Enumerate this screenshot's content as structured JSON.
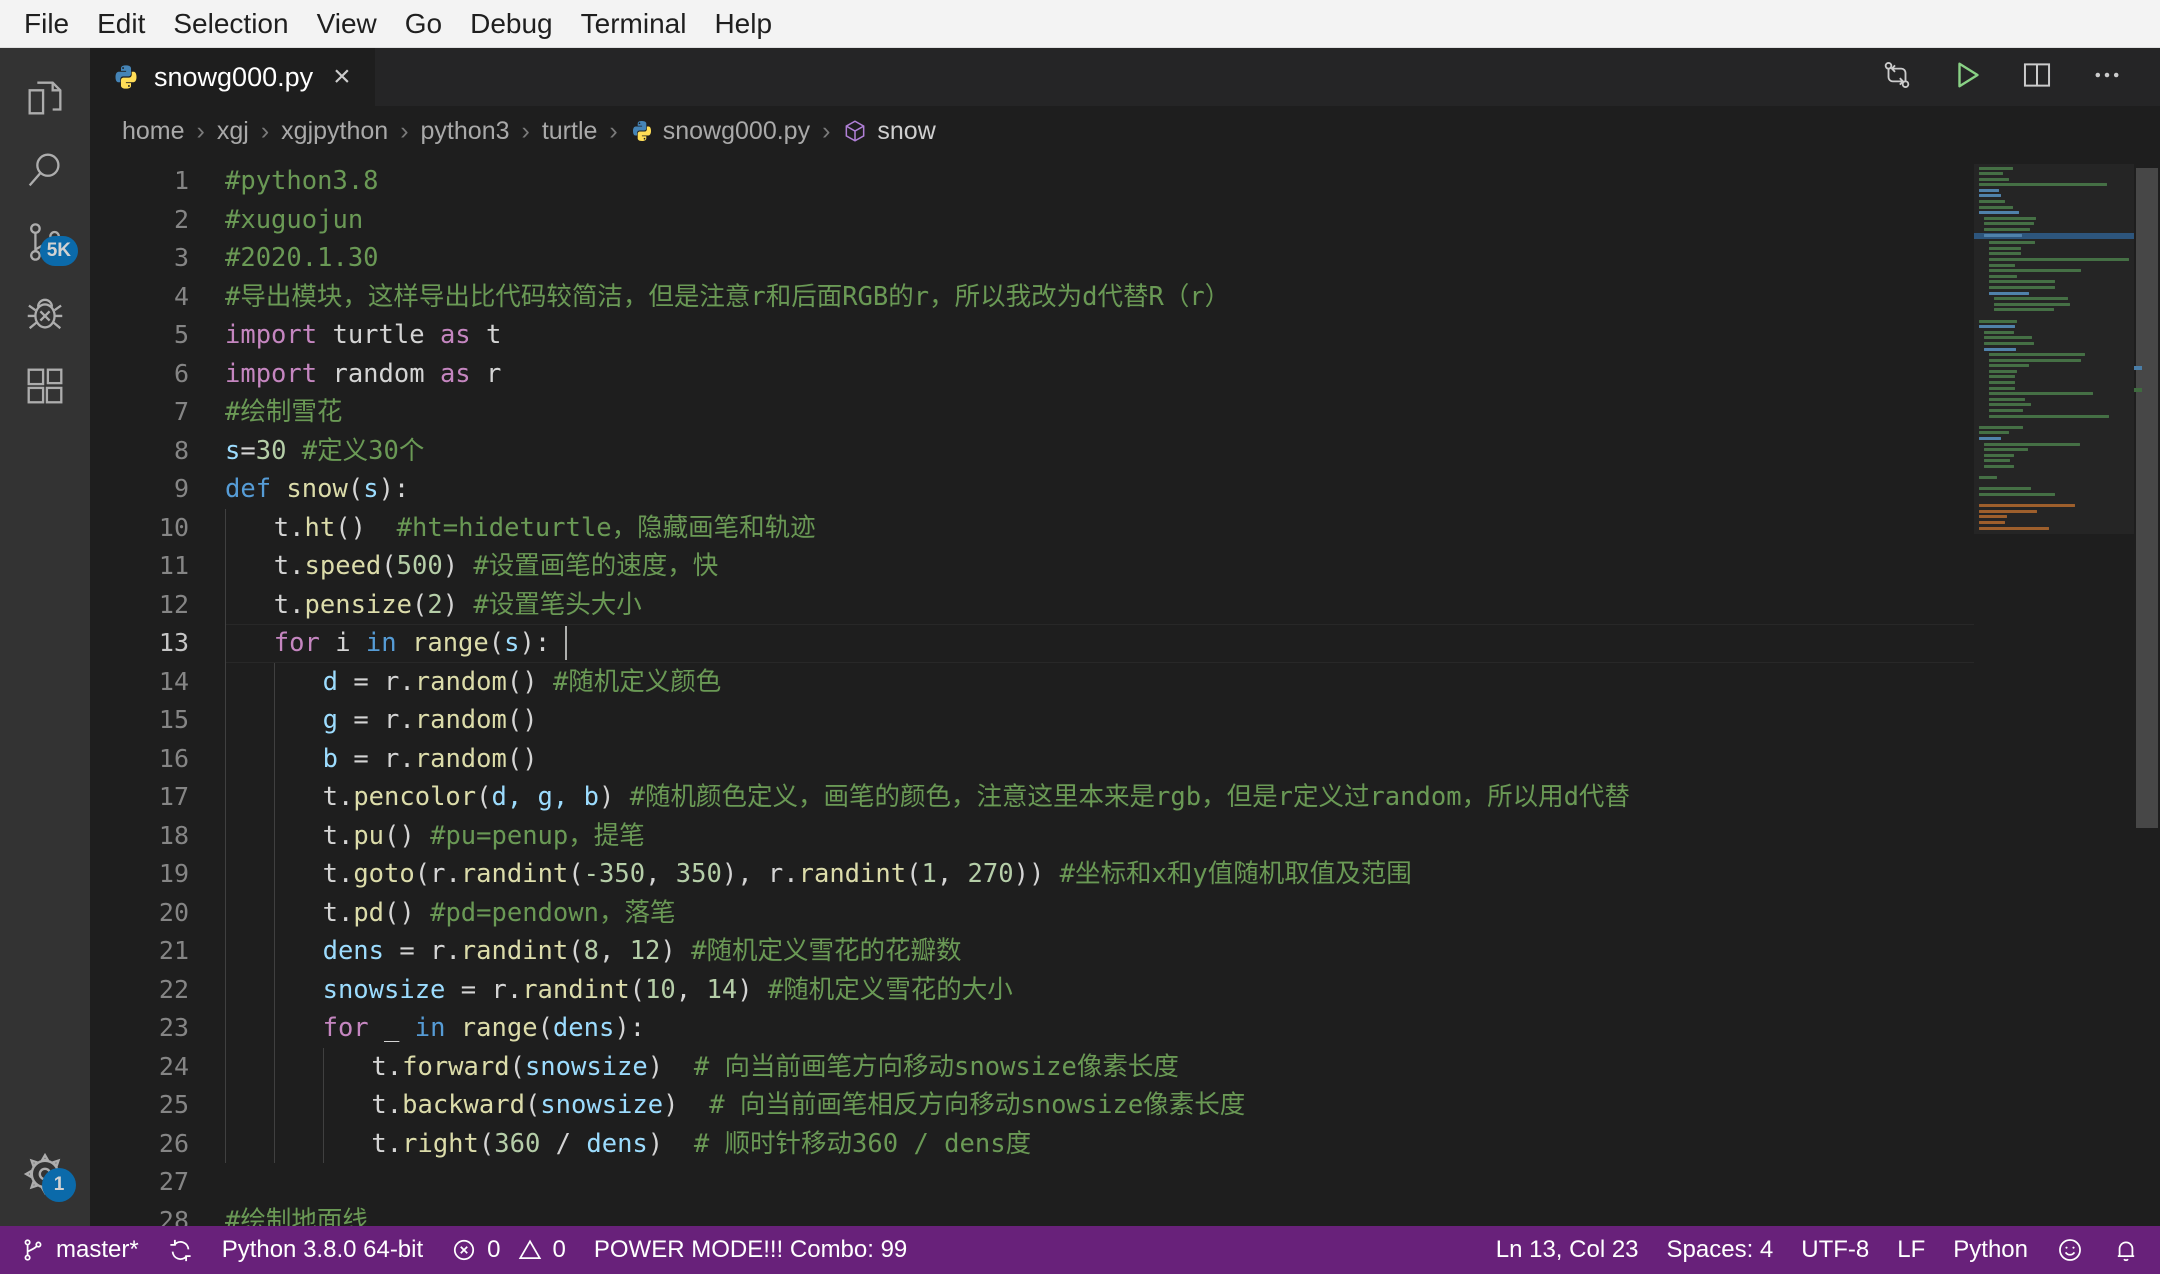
{
  "menubar": {
    "items": [
      "File",
      "Edit",
      "Selection",
      "View",
      "Go",
      "Debug",
      "Terminal",
      "Help"
    ]
  },
  "activitybar": {
    "items": [
      {
        "name": "explorer",
        "icon": "files-icon",
        "badge": null
      },
      {
        "name": "search",
        "icon": "search-icon",
        "badge": null
      },
      {
        "name": "source-control",
        "icon": "source-control-icon",
        "badge": "5K"
      },
      {
        "name": "debug",
        "icon": "debug-icon",
        "badge": null
      },
      {
        "name": "extensions",
        "icon": "extensions-icon",
        "badge": null
      }
    ],
    "manage": {
      "icon": "gear-icon",
      "badge": "1"
    }
  },
  "tabbar": {
    "tab_label": "snowg000.py",
    "tab_icon": "python-file-icon",
    "close_label": "×",
    "actions": [
      {
        "name": "split-compare-button",
        "icon": "compare-icon"
      },
      {
        "name": "run-python-button",
        "icon": "play-icon"
      },
      {
        "name": "split-editor-button",
        "icon": "split-editor-icon"
      },
      {
        "name": "more-actions-button",
        "icon": "ellipsis-icon"
      }
    ]
  },
  "breadcrumb": {
    "items": [
      "home",
      "xgj",
      "xgjpython",
      "python3",
      "turtle",
      "snowg000.py",
      "snow"
    ],
    "separator": "›",
    "file_index": 5,
    "symbol_index": 6
  },
  "editor": {
    "language": "Python",
    "lines": [
      {
        "n": 1,
        "indent": 0,
        "tokens": [
          {
            "t": "#python3.8",
            "c": "c-com"
          }
        ]
      },
      {
        "n": 2,
        "indent": 0,
        "tokens": [
          {
            "t": "#xuguojun",
            "c": "c-com"
          }
        ]
      },
      {
        "n": 3,
        "indent": 0,
        "tokens": [
          {
            "t": "#2020.1.30",
            "c": "c-com"
          }
        ]
      },
      {
        "n": 4,
        "indent": 0,
        "tokens": [
          {
            "t": "#导出模块，这样导出比代码较简洁，但是注意r和后面RGB的r，所以我改为d代替R（r）",
            "c": "c-com"
          }
        ]
      },
      {
        "n": 5,
        "indent": 0,
        "tokens": [
          {
            "t": "import",
            "c": "c-kw"
          },
          {
            "t": " turtle ",
            "c": "c-id"
          },
          {
            "t": "as",
            "c": "c-kw"
          },
          {
            "t": " t",
            "c": "c-id"
          }
        ]
      },
      {
        "n": 6,
        "indent": 0,
        "tokens": [
          {
            "t": "import",
            "c": "c-kw"
          },
          {
            "t": " random ",
            "c": "c-id"
          },
          {
            "t": "as",
            "c": "c-kw"
          },
          {
            "t": " r",
            "c": "c-id"
          }
        ]
      },
      {
        "n": 7,
        "indent": 0,
        "tokens": [
          {
            "t": "#绘制雪花",
            "c": "c-com"
          }
        ]
      },
      {
        "n": 8,
        "indent": 0,
        "tokens": [
          {
            "t": "s",
            "c": "c-var"
          },
          {
            "t": "=",
            "c": "c-op"
          },
          {
            "t": "30",
            "c": "c-num"
          },
          {
            "t": " ",
            "c": "c-id"
          },
          {
            "t": "#定义30个",
            "c": "c-com"
          }
        ]
      },
      {
        "n": 9,
        "indent": 0,
        "tokens": [
          {
            "t": "def",
            "c": "c-kw2"
          },
          {
            "t": " ",
            "c": "c-id"
          },
          {
            "t": "snow",
            "c": "c-fn"
          },
          {
            "t": "(",
            "c": "c-op"
          },
          {
            "t": "s",
            "c": "c-var"
          },
          {
            "t": "):",
            "c": "c-op"
          }
        ]
      },
      {
        "n": 10,
        "indent": 1,
        "tokens": [
          {
            "t": "t",
            "c": "c-id"
          },
          {
            "t": ".",
            "c": "c-op"
          },
          {
            "t": "ht",
            "c": "c-fn"
          },
          {
            "t": "()  ",
            "c": "c-op"
          },
          {
            "t": "#ht=hideturtle，隐藏画笔和轨迹",
            "c": "c-com"
          }
        ]
      },
      {
        "n": 11,
        "indent": 1,
        "tokens": [
          {
            "t": "t",
            "c": "c-id"
          },
          {
            "t": ".",
            "c": "c-op"
          },
          {
            "t": "speed",
            "c": "c-fn"
          },
          {
            "t": "(",
            "c": "c-op"
          },
          {
            "t": "500",
            "c": "c-num"
          },
          {
            "t": ") ",
            "c": "c-op"
          },
          {
            "t": "#设置画笔的速度，快",
            "c": "c-com"
          }
        ]
      },
      {
        "n": 12,
        "indent": 1,
        "tokens": [
          {
            "t": "t",
            "c": "c-id"
          },
          {
            "t": ".",
            "c": "c-op"
          },
          {
            "t": "pensize",
            "c": "c-fn"
          },
          {
            "t": "(",
            "c": "c-op"
          },
          {
            "t": "2",
            "c": "c-num"
          },
          {
            "t": ") ",
            "c": "c-op"
          },
          {
            "t": "#设置笔头大小",
            "c": "c-com"
          }
        ]
      },
      {
        "n": 13,
        "indent": 1,
        "current": true,
        "tokens": [
          {
            "t": "for",
            "c": "c-kw"
          },
          {
            "t": " i ",
            "c": "c-id"
          },
          {
            "t": "in",
            "c": "c-kw2"
          },
          {
            "t": " ",
            "c": "c-id"
          },
          {
            "t": "range",
            "c": "c-fn"
          },
          {
            "t": "(",
            "c": "c-op"
          },
          {
            "t": "s",
            "c": "c-var"
          },
          {
            "t": "):",
            "c": "c-op"
          }
        ]
      },
      {
        "n": 14,
        "indent": 2,
        "tokens": [
          {
            "t": "d ",
            "c": "c-var"
          },
          {
            "t": "= ",
            "c": "c-op"
          },
          {
            "t": "r",
            "c": "c-id"
          },
          {
            "t": ".",
            "c": "c-op"
          },
          {
            "t": "random",
            "c": "c-fn"
          },
          {
            "t": "() ",
            "c": "c-op"
          },
          {
            "t": "#随机定义颜色",
            "c": "c-com"
          }
        ]
      },
      {
        "n": 15,
        "indent": 2,
        "tokens": [
          {
            "t": "g ",
            "c": "c-var"
          },
          {
            "t": "= ",
            "c": "c-op"
          },
          {
            "t": "r",
            "c": "c-id"
          },
          {
            "t": ".",
            "c": "c-op"
          },
          {
            "t": "random",
            "c": "c-fn"
          },
          {
            "t": "()",
            "c": "c-op"
          }
        ]
      },
      {
        "n": 16,
        "indent": 2,
        "tokens": [
          {
            "t": "b ",
            "c": "c-var"
          },
          {
            "t": "= ",
            "c": "c-op"
          },
          {
            "t": "r",
            "c": "c-id"
          },
          {
            "t": ".",
            "c": "c-op"
          },
          {
            "t": "random",
            "c": "c-fn"
          },
          {
            "t": "()",
            "c": "c-op"
          }
        ]
      },
      {
        "n": 17,
        "indent": 2,
        "tokens": [
          {
            "t": "t",
            "c": "c-id"
          },
          {
            "t": ".",
            "c": "c-op"
          },
          {
            "t": "pencolor",
            "c": "c-fn"
          },
          {
            "t": "(",
            "c": "c-op"
          },
          {
            "t": "d, g, b",
            "c": "c-var"
          },
          {
            "t": ") ",
            "c": "c-op"
          },
          {
            "t": "#随机颜色定义，画笔的颜色，注意这里本来是rgb，但是r定义过random，所以用d代替",
            "c": "c-com"
          }
        ]
      },
      {
        "n": 18,
        "indent": 2,
        "tokens": [
          {
            "t": "t",
            "c": "c-id"
          },
          {
            "t": ".",
            "c": "c-op"
          },
          {
            "t": "pu",
            "c": "c-fn"
          },
          {
            "t": "() ",
            "c": "c-op"
          },
          {
            "t": "#pu=penup，提笔",
            "c": "c-com"
          }
        ]
      },
      {
        "n": 19,
        "indent": 2,
        "tokens": [
          {
            "t": "t",
            "c": "c-id"
          },
          {
            "t": ".",
            "c": "c-op"
          },
          {
            "t": "goto",
            "c": "c-fn"
          },
          {
            "t": "(",
            "c": "c-op"
          },
          {
            "t": "r",
            "c": "c-id"
          },
          {
            "t": ".",
            "c": "c-op"
          },
          {
            "t": "randint",
            "c": "c-fn"
          },
          {
            "t": "(",
            "c": "c-op"
          },
          {
            "t": "-350",
            "c": "c-num"
          },
          {
            "t": ", ",
            "c": "c-op"
          },
          {
            "t": "350",
            "c": "c-num"
          },
          {
            "t": "), ",
            "c": "c-op"
          },
          {
            "t": "r",
            "c": "c-id"
          },
          {
            "t": ".",
            "c": "c-op"
          },
          {
            "t": "randint",
            "c": "c-fn"
          },
          {
            "t": "(",
            "c": "c-op"
          },
          {
            "t": "1",
            "c": "c-num"
          },
          {
            "t": ", ",
            "c": "c-op"
          },
          {
            "t": "270",
            "c": "c-num"
          },
          {
            "t": ")) ",
            "c": "c-op"
          },
          {
            "t": "#坐标和x和y值随机取值及范围",
            "c": "c-com"
          }
        ]
      },
      {
        "n": 20,
        "indent": 2,
        "tokens": [
          {
            "t": "t",
            "c": "c-id"
          },
          {
            "t": ".",
            "c": "c-op"
          },
          {
            "t": "pd",
            "c": "c-fn"
          },
          {
            "t": "() ",
            "c": "c-op"
          },
          {
            "t": "#pd=pendown，落笔",
            "c": "c-com"
          }
        ]
      },
      {
        "n": 21,
        "indent": 2,
        "tokens": [
          {
            "t": "dens ",
            "c": "c-var"
          },
          {
            "t": "= ",
            "c": "c-op"
          },
          {
            "t": "r",
            "c": "c-id"
          },
          {
            "t": ".",
            "c": "c-op"
          },
          {
            "t": "randint",
            "c": "c-fn"
          },
          {
            "t": "(",
            "c": "c-op"
          },
          {
            "t": "8",
            "c": "c-num"
          },
          {
            "t": ", ",
            "c": "c-op"
          },
          {
            "t": "12",
            "c": "c-num"
          },
          {
            "t": ") ",
            "c": "c-op"
          },
          {
            "t": "#随机定义雪花的花瓣数",
            "c": "c-com"
          }
        ]
      },
      {
        "n": 22,
        "indent": 2,
        "tokens": [
          {
            "t": "snowsize ",
            "c": "c-var"
          },
          {
            "t": "= ",
            "c": "c-op"
          },
          {
            "t": "r",
            "c": "c-id"
          },
          {
            "t": ".",
            "c": "c-op"
          },
          {
            "t": "randint",
            "c": "c-fn"
          },
          {
            "t": "(",
            "c": "c-op"
          },
          {
            "t": "10",
            "c": "c-num"
          },
          {
            "t": ", ",
            "c": "c-op"
          },
          {
            "t": "14",
            "c": "c-num"
          },
          {
            "t": ") ",
            "c": "c-op"
          },
          {
            "t": "#随机定义雪花的大小",
            "c": "c-com"
          }
        ]
      },
      {
        "n": 23,
        "indent": 2,
        "tokens": [
          {
            "t": "for",
            "c": "c-kw"
          },
          {
            "t": " _ ",
            "c": "c-id"
          },
          {
            "t": "in",
            "c": "c-kw2"
          },
          {
            "t": " ",
            "c": "c-id"
          },
          {
            "t": "range",
            "c": "c-fn"
          },
          {
            "t": "(",
            "c": "c-op"
          },
          {
            "t": "dens",
            "c": "c-var"
          },
          {
            "t": "):",
            "c": "c-op"
          }
        ]
      },
      {
        "n": 24,
        "indent": 3,
        "tokens": [
          {
            "t": "t",
            "c": "c-id"
          },
          {
            "t": ".",
            "c": "c-op"
          },
          {
            "t": "forward",
            "c": "c-fn"
          },
          {
            "t": "(",
            "c": "c-op"
          },
          {
            "t": "snowsize",
            "c": "c-var"
          },
          {
            "t": ")  ",
            "c": "c-op"
          },
          {
            "t": "# 向当前画笔方向移动snowsize像素长度",
            "c": "c-com"
          }
        ]
      },
      {
        "n": 25,
        "indent": 3,
        "tokens": [
          {
            "t": "t",
            "c": "c-id"
          },
          {
            "t": ".",
            "c": "c-op"
          },
          {
            "t": "backward",
            "c": "c-fn"
          },
          {
            "t": "(",
            "c": "c-op"
          },
          {
            "t": "snowsize",
            "c": "c-var"
          },
          {
            "t": ")  ",
            "c": "c-op"
          },
          {
            "t": "# 向当前画笔相反方向移动snowsize像素长度",
            "c": "c-com"
          }
        ]
      },
      {
        "n": 26,
        "indent": 3,
        "tokens": [
          {
            "t": "t",
            "c": "c-id"
          },
          {
            "t": ".",
            "c": "c-op"
          },
          {
            "t": "right",
            "c": "c-fn"
          },
          {
            "t": "(",
            "c": "c-op"
          },
          {
            "t": "360",
            "c": "c-num"
          },
          {
            "t": " / ",
            "c": "c-op"
          },
          {
            "t": "dens",
            "c": "c-var"
          },
          {
            "t": ")  ",
            "c": "c-op"
          },
          {
            "t": "# 顺时针移动360 / dens度",
            "c": "c-com"
          }
        ]
      },
      {
        "n": 27,
        "indent": 0,
        "tokens": []
      },
      {
        "n": 28,
        "indent": 0,
        "tokens": [
          {
            "t": "#绘制地面线",
            "c": "c-com"
          }
        ]
      }
    ]
  },
  "statusbar": {
    "left": [
      {
        "name": "branch",
        "icon": "source-control-icon",
        "label": "master*"
      },
      {
        "name": "sync",
        "icon": "sync-icon",
        "label": ""
      },
      {
        "name": "python-interpreter",
        "icon": "",
        "label": "Python 3.8.0 64-bit"
      },
      {
        "name": "problems",
        "icon": "errors-warnings",
        "label": "0",
        "label2": "0"
      },
      {
        "name": "power-mode",
        "icon": "",
        "label": "POWER MODE!!! Combo: 99"
      }
    ],
    "right": [
      {
        "name": "cursor-position",
        "label": "Ln 13, Col 23"
      },
      {
        "name": "indentation",
        "label": "Spaces: 4"
      },
      {
        "name": "encoding",
        "label": "UTF-8"
      },
      {
        "name": "eol",
        "label": "LF"
      },
      {
        "name": "language-mode",
        "label": "Python"
      },
      {
        "name": "feedback-smiley",
        "label": ""
      },
      {
        "name": "notifications-bell",
        "label": ""
      }
    ]
  },
  "colors": {
    "menubar_bg": "#f3f3f3",
    "activitybar_bg": "#333333",
    "editor_bg": "#1e1e1e",
    "tabbar_bg": "#252526",
    "statusbar_bg": "#68217a",
    "badge_bg": "#007acc",
    "comment": "#6a9955",
    "keyword": "#c586c0",
    "keyword_blue": "#569cd6",
    "function": "#dcdcaa",
    "variable": "#9cdcfe",
    "number": "#b5cea8"
  }
}
